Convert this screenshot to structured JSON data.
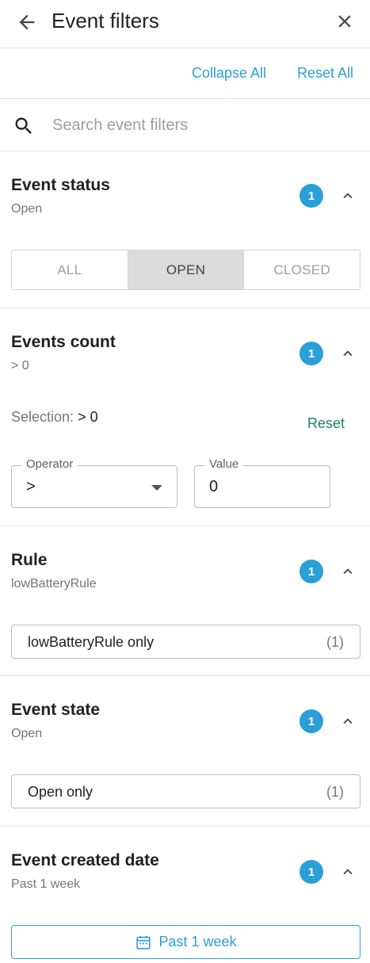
{
  "header": {
    "title": "Event filters",
    "back_icon": "arrow-left-icon",
    "close_icon": "close-icon"
  },
  "actions": {
    "collapse_all": "Collapse All",
    "reset_all": "Reset All"
  },
  "search": {
    "placeholder": "Search event filters",
    "value": ""
  },
  "sections": {
    "status": {
      "title": "Event status",
      "subtitle": "Open",
      "badge": "1",
      "options": [
        "ALL",
        "OPEN",
        "CLOSED"
      ],
      "selected": "OPEN"
    },
    "count": {
      "title": "Events count",
      "subtitle": "> 0",
      "badge": "1",
      "selection_label": "Selection:",
      "selection_value": "> 0",
      "reset": "Reset",
      "operator_label": "Operator",
      "operator_value": ">",
      "value_label": "Value",
      "value_value": "0"
    },
    "rule": {
      "title": "Rule",
      "subtitle": "lowBatteryRule",
      "badge": "1",
      "option_label": "lowBatteryRule only",
      "option_count": "(1)"
    },
    "state": {
      "title": "Event state",
      "subtitle": "Open",
      "badge": "1",
      "option_label": "Open only",
      "option_count": "(1)"
    },
    "date": {
      "title": "Event created date",
      "subtitle": "Past 1 week",
      "badge": "1",
      "button_label": "Past 1 week"
    }
  },
  "colors": {
    "accent": "#2a9fd8",
    "reset_link": "#1e7c6c",
    "segment_active": "#dcdcdc",
    "divider": "#e0e0e0"
  }
}
